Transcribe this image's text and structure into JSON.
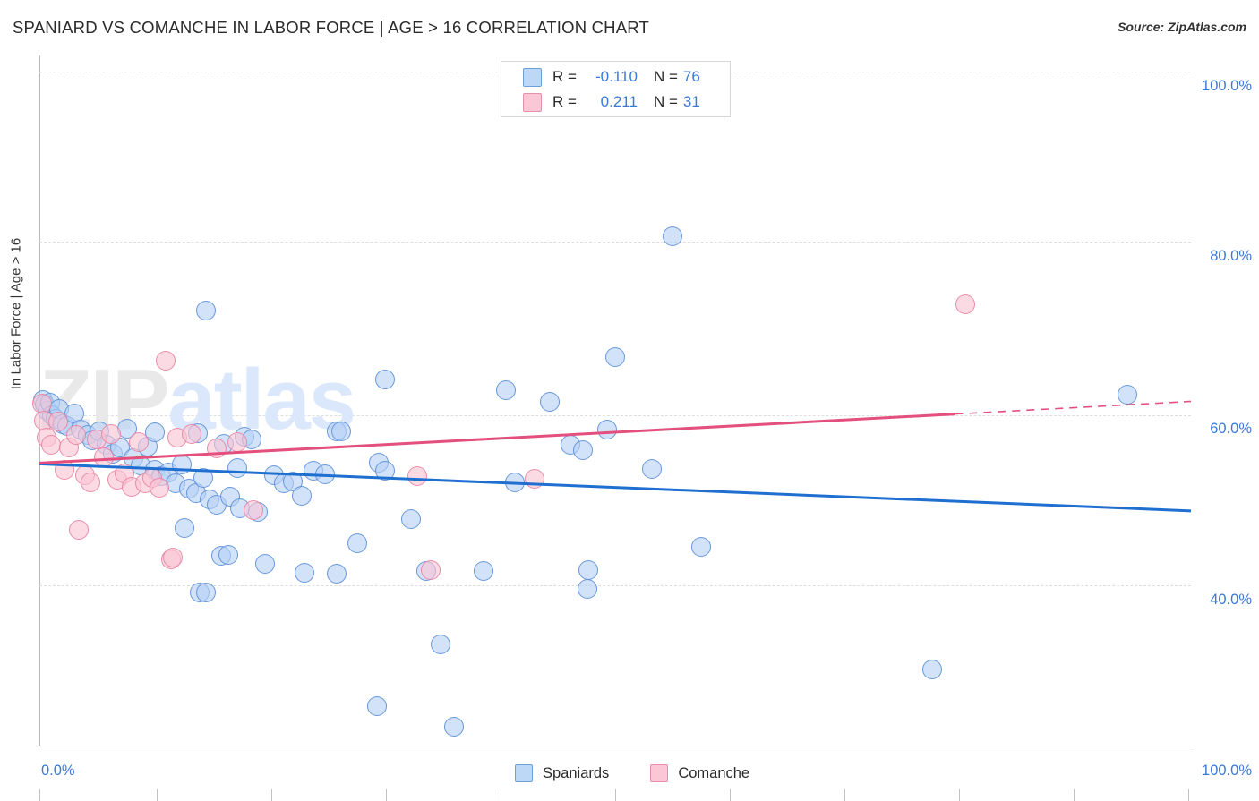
{
  "header": {
    "title": "SPANIARD VS COMANCHE IN LABOR FORCE | AGE > 16 CORRELATION CHART",
    "source": "Source: ZipAtlas.com"
  },
  "watermark": {
    "part1": "ZIP",
    "part2": "atlas"
  },
  "stats": {
    "rows": [
      {
        "series": "Spaniards",
        "color": "#bdd7f7",
        "r_label": "R =",
        "r_value": "-0.110",
        "n_label": "N =",
        "n_value": "76"
      },
      {
        "series": "Comanche",
        "color": "#fbc6d6",
        "r_label": "R =",
        "r_value": "0.211",
        "n_label": "N =",
        "n_value": "31"
      }
    ]
  },
  "legend": {
    "items": [
      {
        "label": "Spaniards",
        "color": "#bdd7f7",
        "border": "#6e9fd8"
      },
      {
        "label": "Comanche",
        "color": "#fbc6d6",
        "border": "#e490ac"
      }
    ]
  },
  "axes": {
    "y_title": "In Labor Force | Age > 16",
    "y_ticks": [
      "100.0%",
      "80.0%",
      "60.0%",
      "40.0%"
    ],
    "x_min": "0.0%",
    "x_max": "100.0%"
  },
  "chart_data": {
    "type": "scatter",
    "title": "SPANIARD VS COMANCHE IN LABOR FORCE | AGE > 16 CORRELATION CHART",
    "xlabel": "",
    "ylabel": "In Labor Force | Age > 16",
    "xlim": [
      0,
      100
    ],
    "ylim": [
      26.5,
      106
    ],
    "x_tick_values": [
      0,
      100
    ],
    "y_tick_values": [
      40,
      60,
      80,
      100
    ],
    "grid": true,
    "legend_position": "bottom-center",
    "colors": {
      "spaniards": "#b4d0f5",
      "spaniards_border": "#568cd4",
      "comanche": "#fac4d4",
      "comanche_border": "#e57a9b",
      "trend_blue": "#1f6fd0",
      "trend_pink": "#e4507e",
      "axis_text": "#3c78d8"
    },
    "series": [
      {
        "name": "Spaniards",
        "r": -0.11,
        "n": 76,
        "trendline": {
          "x0": 0,
          "y0": 59.0,
          "x1": 100,
          "y1": 53.6,
          "style": "solid"
        },
        "points": [
          [
            0.3,
            66.4
          ],
          [
            0.5,
            65.8
          ],
          [
            0.7,
            65.1
          ],
          [
            0.9,
            66.0
          ],
          [
            1.1,
            64.6
          ],
          [
            1.4,
            64.2
          ],
          [
            1.7,
            65.3
          ],
          [
            2.0,
            63.6
          ],
          [
            2.4,
            63.4
          ],
          [
            3.0,
            64.8
          ],
          [
            3.6,
            63.0
          ],
          [
            4.2,
            62.3
          ],
          [
            4.6,
            61.7
          ],
          [
            5.2,
            62.8
          ],
          [
            5.8,
            61.2
          ],
          [
            6.4,
            60.2
          ],
          [
            7.0,
            60.9
          ],
          [
            7.6,
            63.1
          ],
          [
            8.2,
            59.7
          ],
          [
            8.8,
            58.8
          ],
          [
            9.4,
            61.0
          ],
          [
            10.0,
            58.3
          ],
          [
            10.6,
            57.6
          ],
          [
            10.0,
            62.6
          ],
          [
            11.2,
            58.0
          ],
          [
            11.8,
            56.8
          ],
          [
            12.4,
            58.9
          ],
          [
            13.0,
            56.2
          ],
          [
            13.6,
            55.6
          ],
          [
            14.2,
            57.4
          ],
          [
            14.5,
            76.7
          ],
          [
            14.8,
            54.9
          ],
          [
            15.4,
            54.3
          ],
          [
            12.6,
            51.6
          ],
          [
            13.8,
            62.5
          ],
          [
            16.0,
            61.3
          ],
          [
            16.6,
            55.2
          ],
          [
            17.2,
            58.5
          ],
          [
            17.8,
            62.1
          ],
          [
            18.4,
            61.8
          ],
          [
            13.9,
            44.2
          ],
          [
            14.5,
            44.2
          ],
          [
            15.8,
            48.4
          ],
          [
            16.4,
            48.5
          ],
          [
            17.4,
            53.9
          ],
          [
            19.0,
            53.5
          ],
          [
            19.6,
            47.5
          ],
          [
            20.4,
            57.7
          ],
          [
            21.2,
            56.8
          ],
          [
            22.0,
            57.0
          ],
          [
            22.8,
            55.3
          ],
          [
            23.8,
            58.2
          ],
          [
            24.8,
            57.8
          ],
          [
            25.8,
            62.8
          ],
          [
            26.2,
            62.8
          ],
          [
            23.0,
            46.5
          ],
          [
            25.8,
            46.4
          ],
          [
            27.6,
            49.9
          ],
          [
            29.5,
            59.1
          ],
          [
            30.0,
            58.2
          ],
          [
            29.3,
            31.1
          ],
          [
            30.0,
            68.7
          ],
          [
            32.3,
            52.7
          ],
          [
            33.6,
            46.7
          ],
          [
            34.8,
            38.2
          ],
          [
            36.0,
            28.8
          ],
          [
            38.6,
            46.7
          ],
          [
            40.5,
            67.5
          ],
          [
            41.3,
            56.9
          ],
          [
            44.3,
            66.1
          ],
          [
            46.1,
            61.2
          ],
          [
            47.2,
            60.6
          ],
          [
            47.7,
            46.8
          ],
          [
            47.6,
            44.6
          ],
          [
            49.3,
            63.0
          ],
          [
            50.0,
            71.3
          ],
          [
            53.2,
            58.4
          ],
          [
            55.0,
            85.2
          ],
          [
            57.5,
            49.5
          ],
          [
            77.5,
            35.4
          ],
          [
            94.5,
            67.0
          ]
        ]
      },
      {
        "name": "Comanche",
        "r": 0.211,
        "n": 31,
        "trendline": {
          "x0": 0,
          "y0": 59.1,
          "x1": 100,
          "y1": 66.2,
          "style": "solid-then-dashed",
          "dash_start_x": 79.5
        },
        "points": [
          [
            0.2,
            65.9
          ],
          [
            0.4,
            64.0
          ],
          [
            0.6,
            62.0
          ],
          [
            1.0,
            61.2
          ],
          [
            1.6,
            63.9
          ],
          [
            2.2,
            58.3
          ],
          [
            2.6,
            60.9
          ],
          [
            3.2,
            62.3
          ],
          [
            3.4,
            51.4
          ],
          [
            4.0,
            57.7
          ],
          [
            4.4,
            56.9
          ],
          [
            5.0,
            61.8
          ],
          [
            5.6,
            59.8
          ],
          [
            6.2,
            62.4
          ],
          [
            6.8,
            57.2
          ],
          [
            7.4,
            57.9
          ],
          [
            8.0,
            56.4
          ],
          [
            8.6,
            61.5
          ],
          [
            9.2,
            56.8
          ],
          [
            9.8,
            57.4
          ],
          [
            10.4,
            56.3
          ],
          [
            11.0,
            70.9
          ],
          [
            11.4,
            48.0
          ],
          [
            11.6,
            48.2
          ],
          [
            12.0,
            62.0
          ],
          [
            13.2,
            62.4
          ],
          [
            15.4,
            60.8
          ],
          [
            17.2,
            61.5
          ],
          [
            18.6,
            53.7
          ],
          [
            32.8,
            57.6
          ],
          [
            34.0,
            46.8
          ],
          [
            43.0,
            57.3
          ],
          [
            80.4,
            77.4
          ]
        ]
      }
    ]
  }
}
